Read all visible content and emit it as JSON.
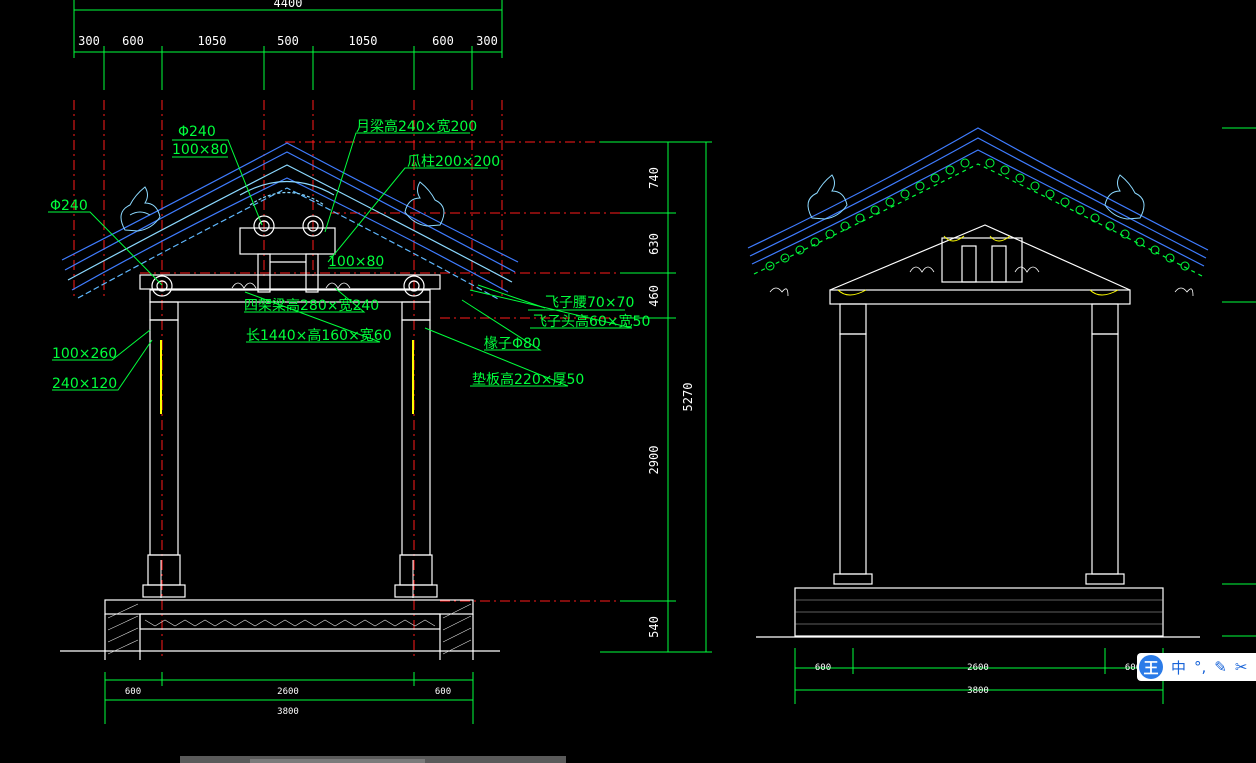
{
  "top_dims": {
    "overall": "4400",
    "segments": [
      "300",
      "600",
      "1050",
      "500",
      "1050",
      "600",
      "300"
    ]
  },
  "annotations": {
    "phi240_top": "Φ240",
    "size100x80_top": "100×80",
    "phi240_left": "Φ240",
    "yueliang": "月梁高240×宽200",
    "guazhu": "瓜柱200×200",
    "size100x80_mid": "100×80",
    "sijialiang": "四架梁高280×宽240",
    "chang1440": "长1440×高160×宽60",
    "size100x260": "100×260",
    "size240x120": "240×120",
    "feizi_yao": "飞子腰70×70",
    "feizi_tou": "飞子头高60×宽50",
    "chuanzi": "椽子Φ80",
    "dianban": "垫板高220×厚50"
  },
  "right_dims": {
    "d740": "740",
    "d630": "630",
    "d460": "460",
    "d5270": "5270",
    "d2900": "2900",
    "d540": "540"
  },
  "bottom_dims_left": {
    "a": "600",
    "b": "2600",
    "c": "600",
    "total": "3800"
  },
  "bottom_dims_right": {
    "a": "600",
    "b": "2600",
    "c": "600",
    "total": "3800"
  },
  "ime_toolbar": {
    "logo": "王",
    "mode": "中",
    "punct": "°,",
    "icons": [
      "pen-icon",
      "scissors-icon"
    ]
  },
  "colors": {
    "background": "#000000",
    "dim_line": "#00ff3c",
    "label_text": "#00ff3c",
    "center_line": "#ff1a1a",
    "structure": "#ffffff",
    "roof_tile": "#3f7cff",
    "ornament": "#8cd9ff",
    "highlight": "#ffff00"
  }
}
